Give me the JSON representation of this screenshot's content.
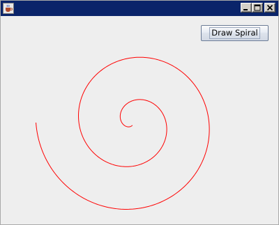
{
  "window": {
    "title": "",
    "title_bar_color": "#0a246a"
  },
  "toolbar": {
    "draw_spiral_label": "Draw Spiral"
  },
  "icons": {
    "app": "java-cup-icon",
    "minimize": "minimize-icon",
    "maximize": "maximize-icon",
    "close": "close-icon"
  },
  "spiral": {
    "color": "#ff0000",
    "turns": 2.2
  }
}
